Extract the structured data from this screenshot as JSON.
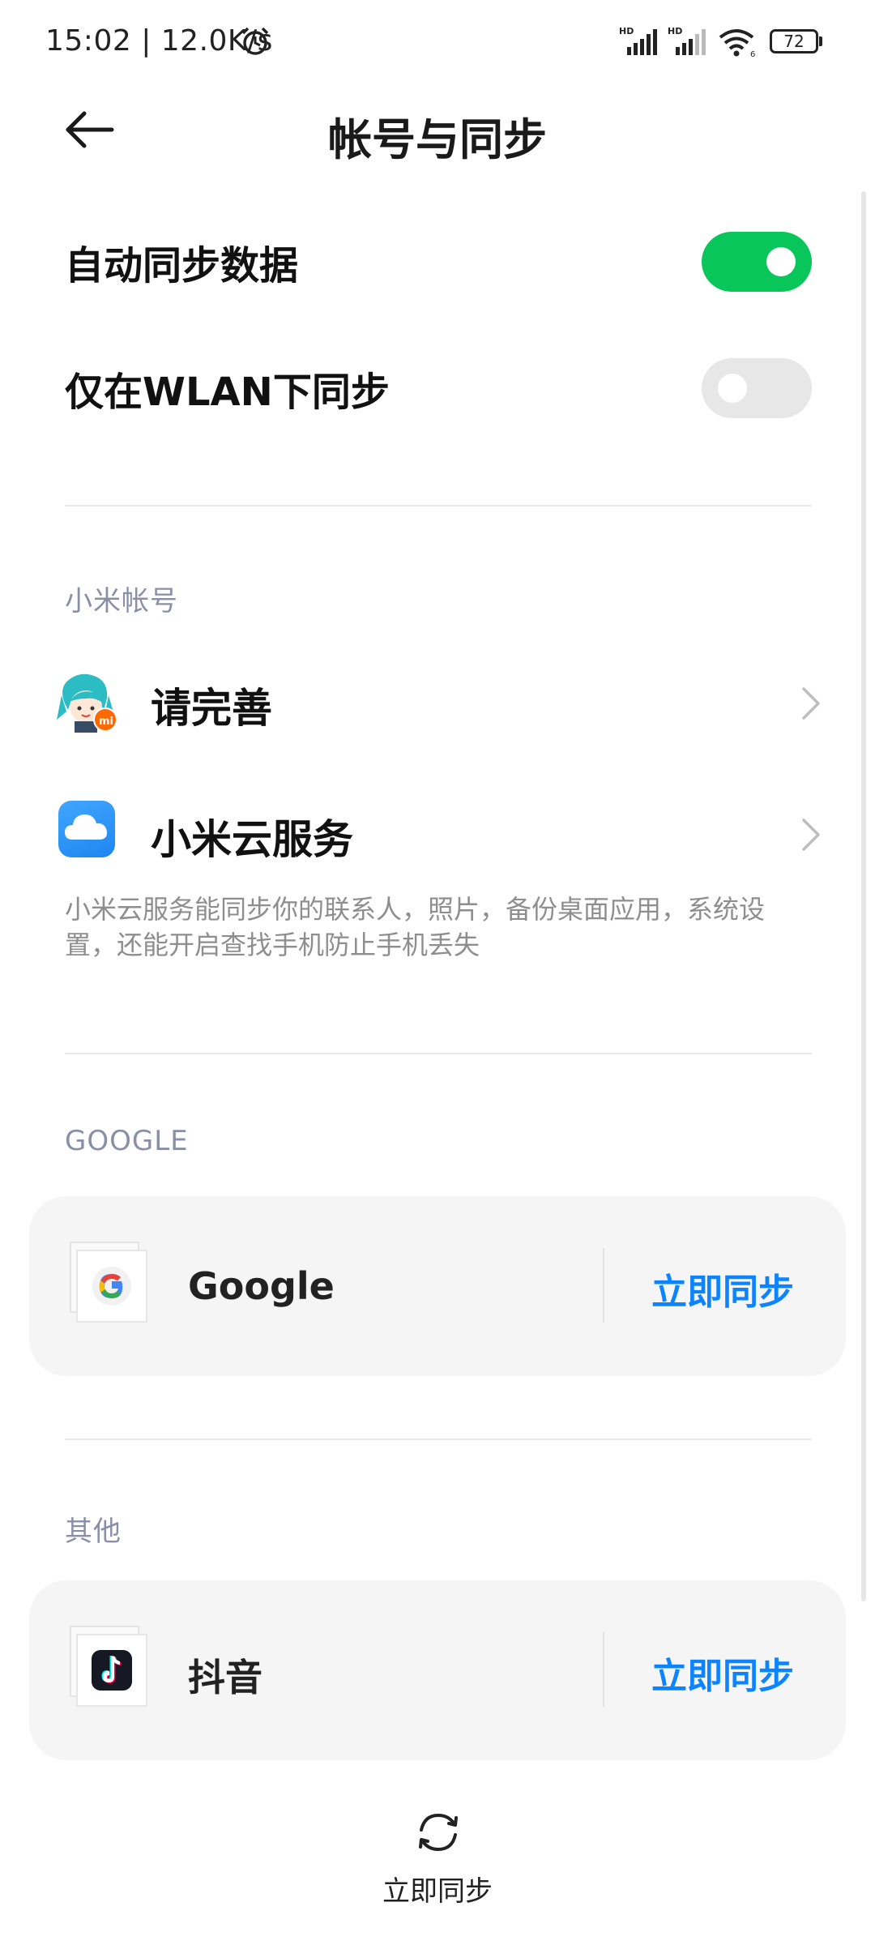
{
  "status_bar": {
    "time_speed": "15:02 | 12.0K/s",
    "battery_level": "72"
  },
  "header": {
    "title": "帐号与同步"
  },
  "settings": {
    "auto_sync_label": "自动同步数据",
    "auto_sync_on": true,
    "wlan_only_label": "仅在WLAN下同步",
    "wlan_only_on": false
  },
  "xiaomi_section": {
    "header": "小米帐号",
    "profile_label": "请完善",
    "cloud_label": "小米云服务",
    "description": "小米云服务能同步你的联系人，照片，备份桌面应用，系统设置，还能开启查找手机防止手机丢失"
  },
  "google_section": {
    "header": "GOOGLE",
    "account_label": "Google",
    "sync_label": "立即同步"
  },
  "other_section": {
    "header": "其他",
    "account_label": "抖音",
    "sync_label": "立即同步"
  },
  "bottom": {
    "sync_label": "立即同步"
  },
  "colors": {
    "toggle_on": "#09c65a",
    "toggle_off": "#e7e7e7",
    "accent_blue": "#0d84ff",
    "section_header": "#8a8fa8",
    "card_bg": "#f5f5f5"
  },
  "icons": {
    "back": "arrow-left-icon",
    "alarm": "alarm-clock-icon",
    "signal": "cellular-signal-icon",
    "wifi": "wifi-icon",
    "chevron": "chevron-right-icon",
    "cloud": "xiaomi-cloud-icon",
    "google": "google-g-icon",
    "tiktok": "douyin-icon",
    "sync": "sync-refresh-icon"
  }
}
